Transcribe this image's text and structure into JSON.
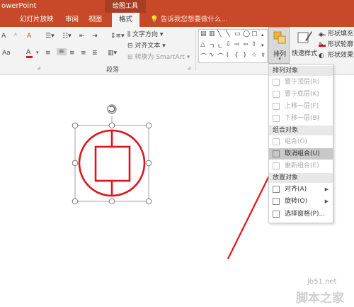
{
  "titlebar": {
    "app_title": "owerPoint",
    "context_label": "绘图工具"
  },
  "tabs": [
    {
      "label": "幻灯片放映"
    },
    {
      "label": "审阅"
    },
    {
      "label": "视图"
    },
    {
      "label": "格式"
    }
  ],
  "tell_me": "告诉我您想要做什么...",
  "ribbon": {
    "text_direction": "文字方向",
    "align_text": "对齐文本",
    "convert_smartart": "转换为 SmartArt",
    "paragraph_group": "段落",
    "font_size_glyph": "Aa",
    "font_color_glyph": "A",
    "arrange_label": "排列",
    "quick_styles_label": "快速样式",
    "shape_fill": "形状填充",
    "shape_outline": "形状轮廓",
    "shape_effects": "形状效果"
  },
  "arrange_menu": {
    "sections": [
      {
        "header": "排列对象",
        "items": [
          {
            "label": "置于顶层(R)",
            "disabled": true
          },
          {
            "label": "置于底层(K)",
            "disabled": true
          },
          {
            "label": "上移一层(F)",
            "disabled": true
          },
          {
            "label": "下移一层(B)",
            "disabled": true
          }
        ]
      },
      {
        "header": "组合对象",
        "items": [
          {
            "label": "组合(G)",
            "disabled": true
          },
          {
            "label": "取消组合(U)",
            "disabled": false,
            "highlighted": true
          },
          {
            "label": "重新组合(E)",
            "disabled": true
          }
        ]
      },
      {
        "header": "放置对象",
        "items": [
          {
            "label": "对齐(A)",
            "disabled": false,
            "submenu": true
          },
          {
            "label": "旋转(O)",
            "disabled": false,
            "submenu": true
          },
          {
            "label": "选择窗格(P)...",
            "disabled": false
          }
        ]
      }
    ]
  },
  "watermark": {
    "site": "jb51.net",
    "name": "脚本之家"
  },
  "colors": {
    "accent": "#c8492a",
    "shape_red": "#e0141b",
    "arrow_red": "#e0141b"
  }
}
